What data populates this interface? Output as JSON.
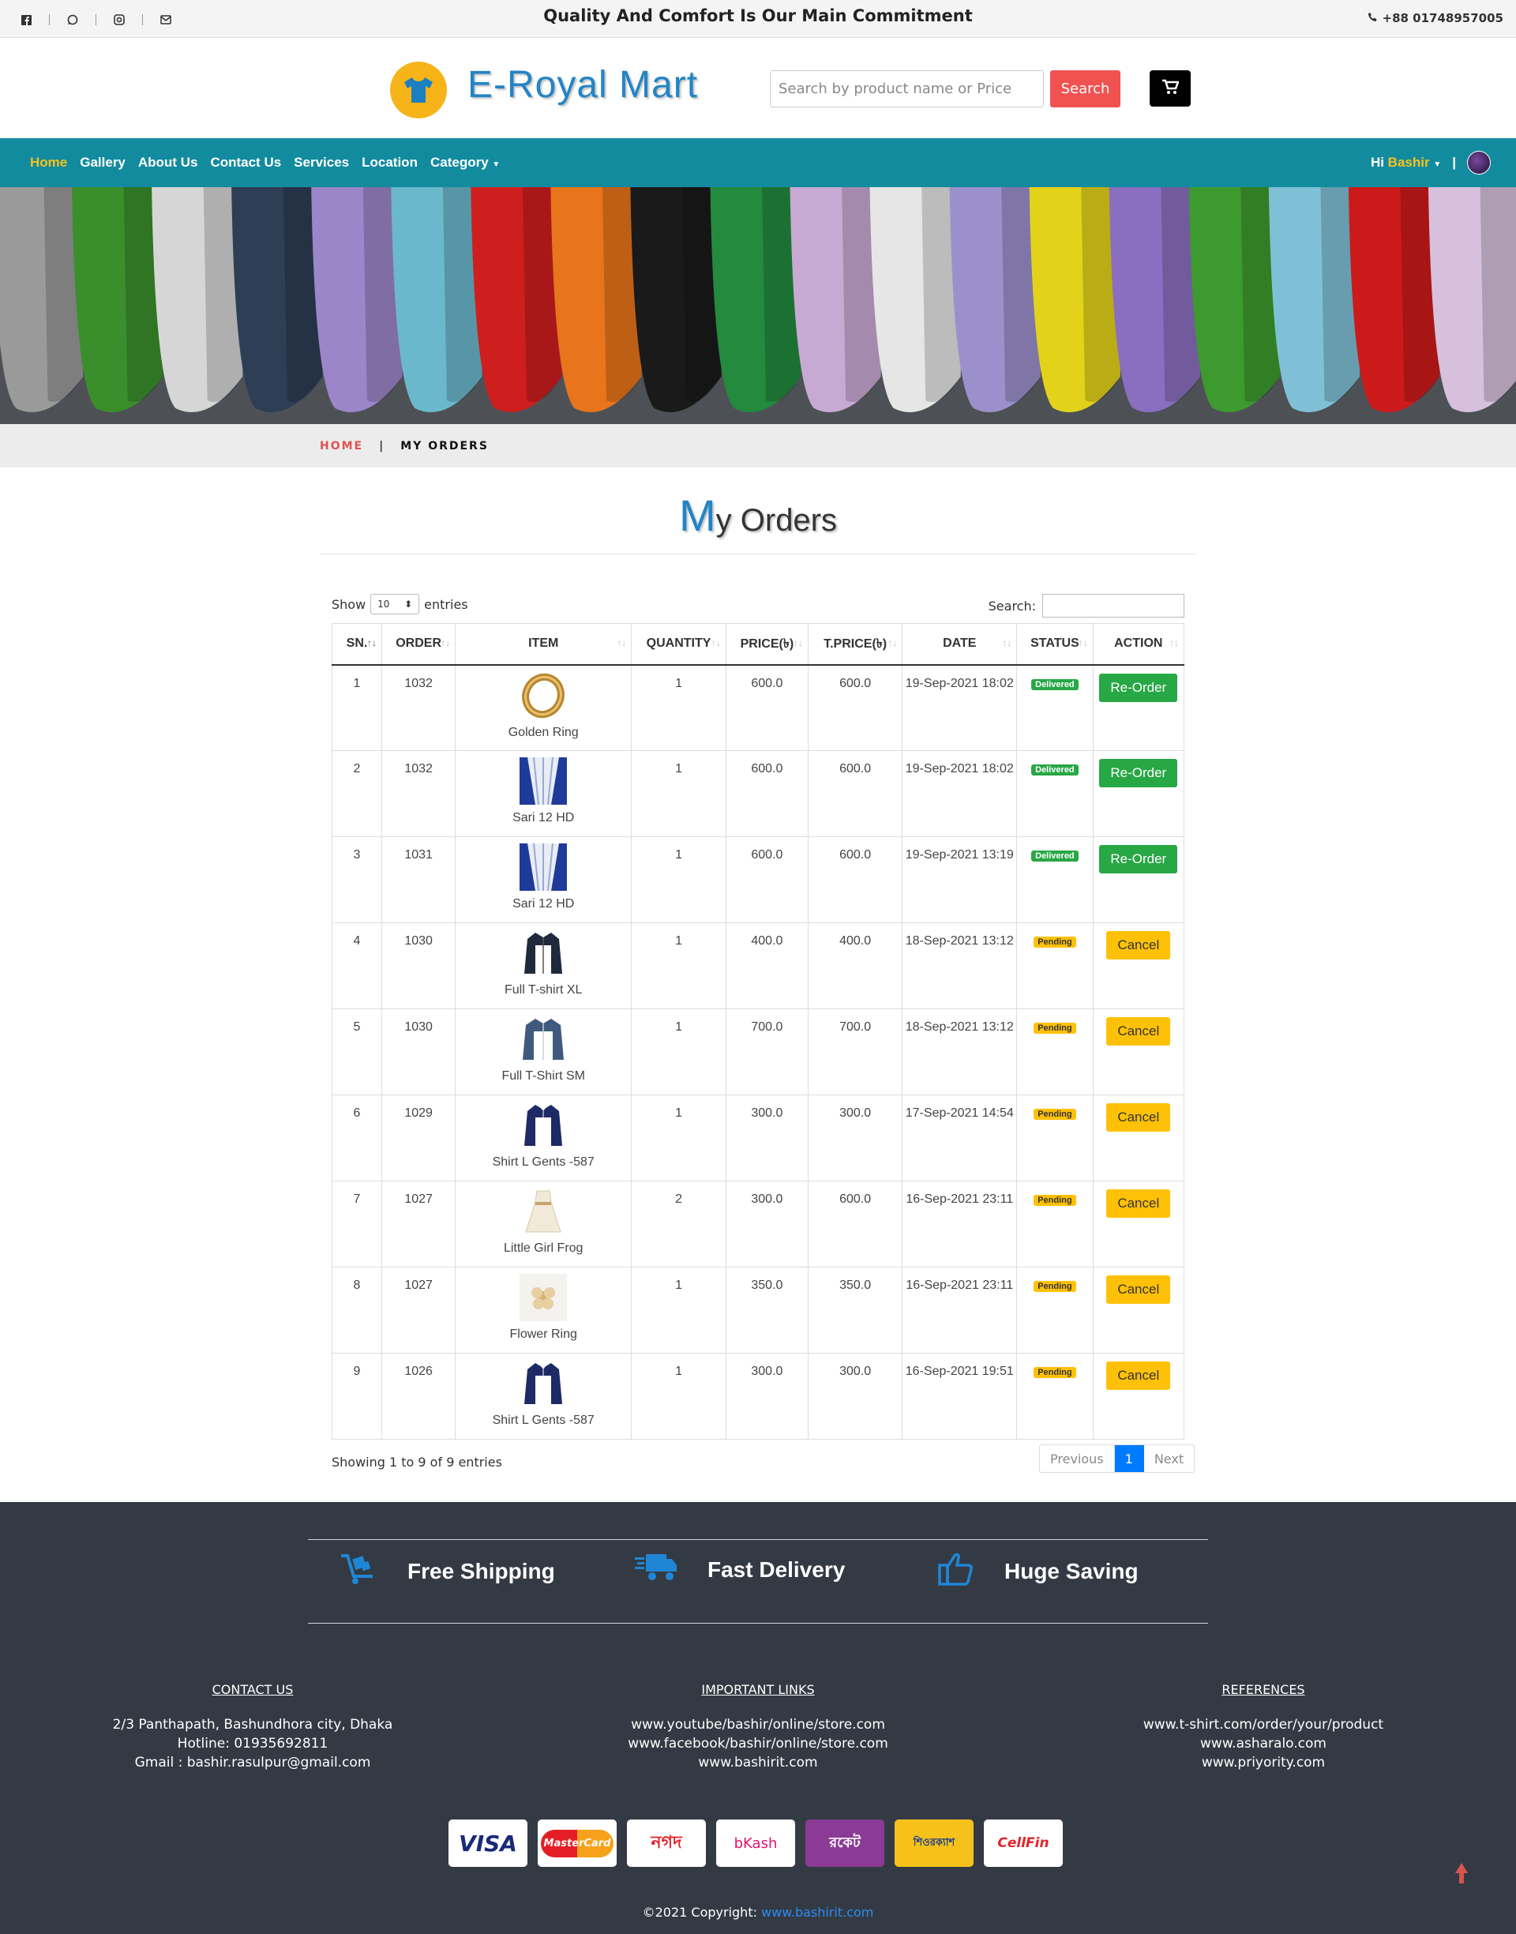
{
  "topbar": {
    "tagline": "Quality And Comfort Is Our Main Commitment",
    "phone": "+88 01748957005",
    "socials": [
      "facebook-icon",
      "whatsapp-icon",
      "instagram-icon",
      "email-icon"
    ]
  },
  "header": {
    "brand": "E-Royal Mart",
    "search_placeholder": "Search by product name or Price",
    "search_button": "Search"
  },
  "nav": {
    "items": [
      "Home",
      "Gallery",
      "About Us",
      "Contact Us",
      "Services",
      "Location",
      "Category"
    ],
    "greeting": "Hi",
    "user": "Bashir",
    "divider": "|"
  },
  "breadcrumb": {
    "home": "HOME",
    "sep": "|",
    "current": "MY ORDERS"
  },
  "page": {
    "title_first": "M",
    "title_rest": "y Orders"
  },
  "table": {
    "show_label": "Show",
    "entries_value": "10",
    "entries_label": "entries",
    "search_label": "Search:",
    "headers": [
      "SN.",
      "ORDER",
      "ITEM",
      "QUANTITY",
      "PRICE(৳)",
      "T.PRICE(৳)",
      "DATE",
      "STATUS",
      "ACTION"
    ],
    "rows": [
      {
        "sn": "1",
        "order": "1032",
        "item": "Golden Ring",
        "qty": "1",
        "price": "600.0",
        "tprice": "600.0",
        "date": "19-Sep-2021 18:02",
        "status": "Delivered",
        "action": "Re-Order",
        "img": "ring"
      },
      {
        "sn": "2",
        "order": "1032",
        "item": "Sari 12 HD",
        "qty": "1",
        "price": "600.0",
        "tprice": "600.0",
        "date": "19-Sep-2021 18:02",
        "status": "Delivered",
        "action": "Re-Order",
        "img": "sari"
      },
      {
        "sn": "3",
        "order": "1031",
        "item": "Sari 12 HD",
        "qty": "1",
        "price": "600.0",
        "tprice": "600.0",
        "date": "19-Sep-2021 13:19",
        "status": "Delivered",
        "action": "Re-Order",
        "img": "sari"
      },
      {
        "sn": "4",
        "order": "1030",
        "item": "Full T-shirt XL",
        "qty": "1",
        "price": "400.0",
        "tprice": "400.0",
        "date": "18-Sep-2021 13:12",
        "status": "Pending",
        "action": "Cancel",
        "img": "jacket"
      },
      {
        "sn": "5",
        "order": "1030",
        "item": "Full T-Shirt SM",
        "qty": "1",
        "price": "700.0",
        "tprice": "700.0",
        "date": "18-Sep-2021 13:12",
        "status": "Pending",
        "action": "Cancel",
        "img": "denim"
      },
      {
        "sn": "6",
        "order": "1029",
        "item": "Shirt L Gents -587",
        "qty": "1",
        "price": "300.0",
        "tprice": "300.0",
        "date": "17-Sep-2021 14:54",
        "status": "Pending",
        "action": "Cancel",
        "img": "shirt"
      },
      {
        "sn": "7",
        "order": "1027",
        "item": "Little Girl Frog",
        "qty": "2",
        "price": "300.0",
        "tprice": "600.0",
        "date": "16-Sep-2021 23:11",
        "status": "Pending",
        "action": "Cancel",
        "img": "dress"
      },
      {
        "sn": "8",
        "order": "1027",
        "item": "Flower Ring",
        "qty": "1",
        "price": "350.0",
        "tprice": "350.0",
        "date": "16-Sep-2021 23:11",
        "status": "Pending",
        "action": "Cancel",
        "img": "flower"
      },
      {
        "sn": "9",
        "order": "1026",
        "item": "Shirt L Gents -587",
        "qty": "1",
        "price": "300.0",
        "tprice": "300.0",
        "date": "16-Sep-2021 19:51",
        "status": "Pending",
        "action": "Cancel",
        "img": "shirt"
      }
    ],
    "info": "Showing 1 to 9 of 9 entries",
    "pager": {
      "prev": "Previous",
      "current": "1",
      "next": "Next"
    }
  },
  "footer": {
    "features": [
      "Free Shipping",
      "Fast Delivery",
      "Huge Saving"
    ],
    "contact": {
      "heading": "CONTACT US",
      "lines": [
        "2/3 Panthapath, Bashundhora city, Dhaka",
        "Hotline: 01935692811",
        "Gmail : bashir.rasulpur@gmail.com"
      ]
    },
    "links": {
      "heading": "IMPORTANT LINKS",
      "lines": [
        "www.youtube/bashir/online/store.com",
        "www.facebook/bashir/online/store.com",
        "www.bashirit.com"
      ]
    },
    "refs": {
      "heading": "REFERENCES",
      "lines": [
        "www.t-shirt.com/order/your/product",
        "www.asharalo.com",
        "www.priyority.com"
      ]
    },
    "payments": [
      "VISA",
      "MasterCard",
      "নগদ",
      "bKash",
      "রকেট",
      "শিওরক্যাশ",
      "CellFin"
    ],
    "copyright": "©2021 Copyright:",
    "copyright_link": "www.bashirit.com"
  }
}
